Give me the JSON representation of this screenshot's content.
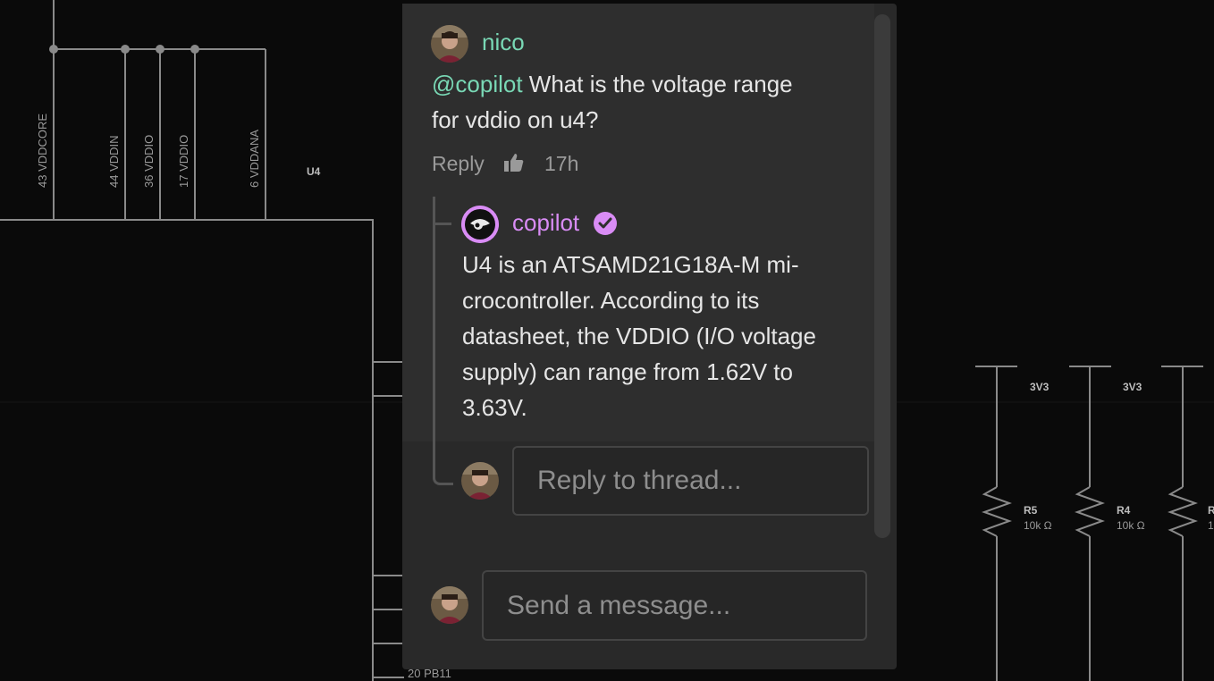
{
  "schematic": {
    "pins": [
      "43  VDDCORE",
      "44  VDDIN",
      "36  VDDIO",
      "17  VDDIO",
      "6  VDDANA"
    ],
    "component_ref": "U4",
    "bottom_pin_partial": "20  PB11",
    "power_labels": [
      "3V3",
      "3V3"
    ],
    "resistors": [
      {
        "ref": "R5",
        "value": "10k Ω"
      },
      {
        "ref": "R4",
        "value": "10k Ω"
      },
      {
        "ref": "R",
        "value": "1"
      }
    ]
  },
  "comment": {
    "author": "nico",
    "mention": "@copilot",
    "text_line1": " What is the voltage range",
    "text_line2": "for vddio on u4?",
    "reply_label": "Reply",
    "time": "17h"
  },
  "reply": {
    "author": "copilot",
    "lines": [
      "U4 is an ATSAMD21G18A-M mi-",
      "crocontroller. According to its",
      "datasheet, the VDDIO (I/O voltage",
      "supply) can range from 1.62V to",
      "3.63V."
    ]
  },
  "reply_input": {
    "placeholder": "Reply to thread..."
  },
  "message_input": {
    "placeholder": "Send a message..."
  },
  "colors": {
    "accent_green": "#79d8b5",
    "accent_purple": "#d98cf5",
    "panel_bg": "#292929"
  },
  "icons": [
    "thumbs-up-icon",
    "verified-badge-icon",
    "avatar-icon",
    "copilot-logo-icon"
  ]
}
